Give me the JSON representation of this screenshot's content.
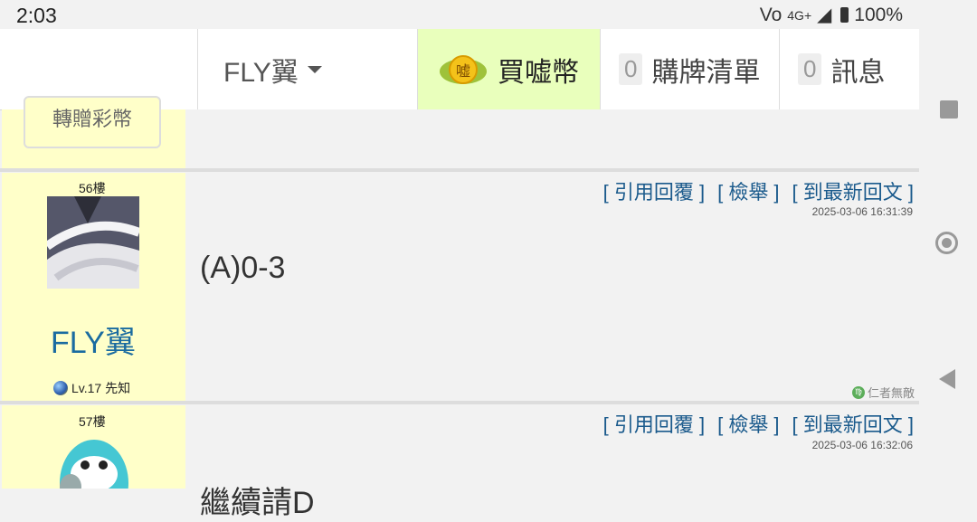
{
  "status_bar": {
    "time": "2:03",
    "network": "4G+",
    "volte": "Vo",
    "battery": "100%"
  },
  "header": {
    "username": "FLY翼",
    "buy_coin_label": "買嘘幣",
    "coin_icon_text": "嘘",
    "cart": {
      "count": "0",
      "label": "購牌清單"
    },
    "messages": {
      "count": "0",
      "label": "訊息"
    }
  },
  "prev_post": {
    "gift_button": "轉贈彩幣"
  },
  "posts": [
    {
      "floor": "56樓",
      "actions": [
        "[ 引用回覆 ]",
        "[ 檢舉 ]",
        "[ 到最新回文 ]"
      ],
      "timestamp": "2025-03-06 16:31:39",
      "content": "(A)0-3",
      "username": "FLY翼",
      "level": "Lv.17 先知",
      "signature": "仁者無敵",
      "signature_icon": "♍"
    },
    {
      "floor": "57樓",
      "actions": [
        "[ 引用回覆 ]",
        "[ 檢舉 ]",
        "[ 到最新回文 ]"
      ],
      "timestamp": "2025-03-06 16:32:06",
      "content": "繼續請D"
    }
  ],
  "colors": {
    "accent": "#1a6ba0",
    "buy_bg": "#e9ffbc",
    "user_col": "#ffffc9"
  }
}
